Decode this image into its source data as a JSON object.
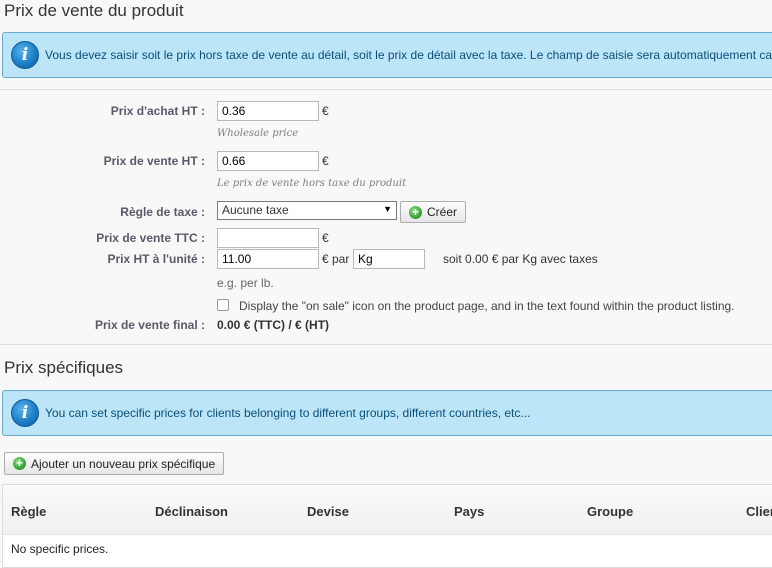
{
  "section1": {
    "title": "Prix de vente du produit",
    "info": "Vous devez saisir soit le prix hors taxe de vente au détail, soit le prix de détail avec la taxe. Le champ de saisie sera automatiquement ca"
  },
  "form": {
    "wholesale": {
      "label": "Prix d'achat HT :",
      "value": "0.36",
      "currency": "€",
      "hint": "Wholesale price"
    },
    "retail": {
      "label": "Prix de vente HT :",
      "value": "0.66",
      "currency": "€",
      "hint": "Le prix de vente hors taxe du produit"
    },
    "tax_rule": {
      "label": "Règle de taxe :",
      "selected": "Aucune taxe",
      "create_button": "Créer"
    },
    "retail_ttc": {
      "label": "Prix de vente TTC :",
      "value": "",
      "currency": "€"
    },
    "unit_price": {
      "label": "Prix HT à l'unité :",
      "value": "11.00",
      "currency_par": "€ par",
      "unit": "Kg",
      "summary": "soit 0.00 € par Kg avec taxes",
      "hint": "e.g. per lb."
    },
    "on_sale": {
      "label": "Display the \"on sale\" icon on the product page, and in the text found within the product listing.",
      "checked": false
    },
    "final_price": {
      "label": "Prix de vente final :",
      "value": "0.00 € (TTC) / € (HT)"
    }
  },
  "section2": {
    "title": "Prix spécifiques",
    "info": "You can set specific prices for clients belonging to different groups, different countries, etc...",
    "add_button": "Ajouter un nouveau prix spécifique",
    "table": {
      "headers": [
        "Règle",
        "Déclinaison",
        "Devise",
        "Pays",
        "Groupe",
        "Clien"
      ],
      "empty_message": "No specific prices."
    }
  },
  "colors": {
    "info_bg": "#bde5f8",
    "info_border": "#67a7ce",
    "info_text": "#0a4f79",
    "label": "#585a69"
  }
}
